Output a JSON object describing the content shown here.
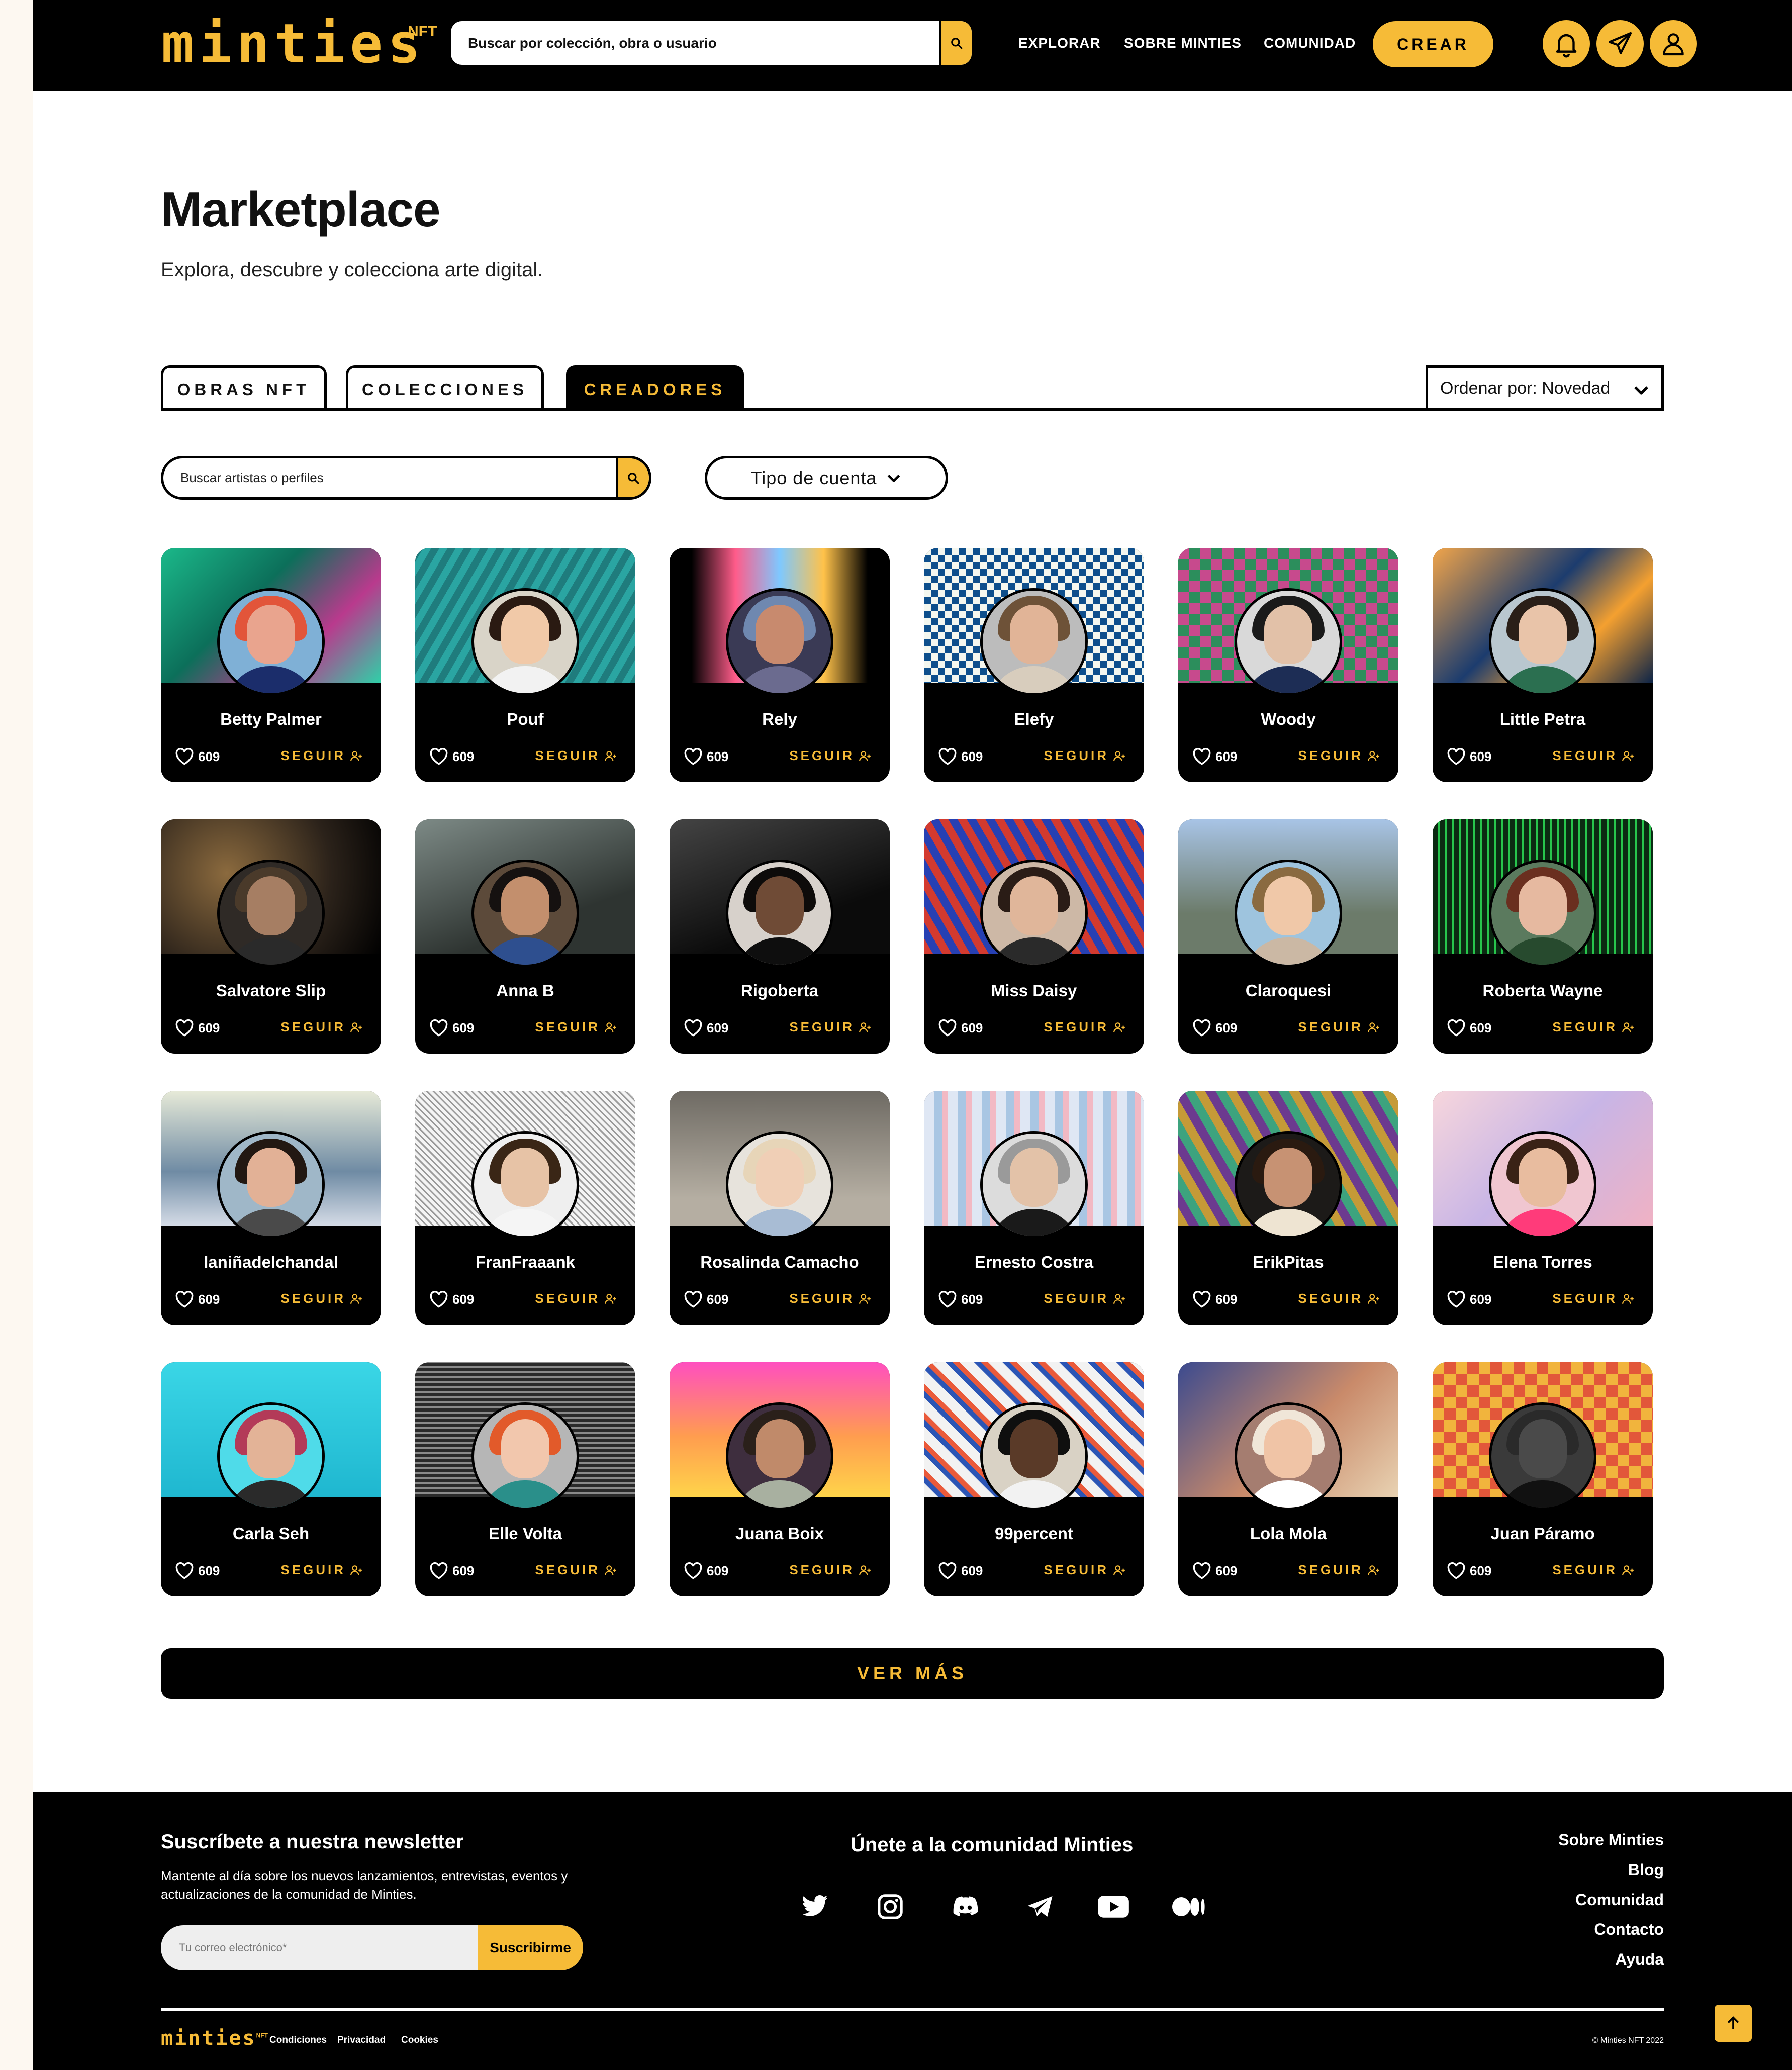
{
  "header": {
    "logo": "minties",
    "logo_sup": "NFT",
    "search_placeholder": "Buscar por colección, obra o usuario",
    "nav": [
      "EXPLORAR",
      "SOBRE MINTIES",
      "COMUNIDAD"
    ],
    "create_label": "CREAR",
    "icons": [
      "bell-icon",
      "paper-plane-icon",
      "user-icon"
    ]
  },
  "main": {
    "title": "Marketplace",
    "subtitle": "Explora, descubre y colecciona arte digital.",
    "tabs": [
      {
        "label": "OBRAS NFT",
        "active": false
      },
      {
        "label": "COLECCIONES",
        "active": false
      },
      {
        "label": "CREADORES",
        "active": true
      }
    ],
    "sort_label": "Ordenar por: Novedad",
    "filter_search_placeholder": "Buscar artistas o perfiles",
    "account_type_label": "Tipo de cuenta",
    "follow_label": "SEGUIR",
    "more_label": "VER MÁS"
  },
  "creators": [
    {
      "name": "Betty Palmer",
      "likes": "609"
    },
    {
      "name": "Pouf",
      "likes": "609"
    },
    {
      "name": "Rely",
      "likes": "609"
    },
    {
      "name": "Elefy",
      "likes": "609"
    },
    {
      "name": "Woody",
      "likes": "609"
    },
    {
      "name": "Little Petra",
      "likes": "609"
    },
    {
      "name": "Salvatore Slip",
      "likes": "609"
    },
    {
      "name": "Anna B",
      "likes": "609"
    },
    {
      "name": "Rigoberta",
      "likes": "609"
    },
    {
      "name": "Miss Daisy",
      "likes": "609"
    },
    {
      "name": "Claroquesi",
      "likes": "609"
    },
    {
      "name": "Roberta Wayne",
      "likes": "609"
    },
    {
      "name": "Ianiñadelchandal",
      "likes": "609"
    },
    {
      "name": "FranFraaank",
      "likes": "609"
    },
    {
      "name": "Rosalinda Camacho",
      "likes": "609"
    },
    {
      "name": "Ernesto Costra",
      "likes": "609"
    },
    {
      "name": "ErikPitas",
      "likes": "609"
    },
    {
      "name": "Elena Torres",
      "likes": "609"
    },
    {
      "name": "Carla Seh",
      "likes": "609"
    },
    {
      "name": "Elle Volta",
      "likes": "609"
    },
    {
      "name": "Juana Boix",
      "likes": "609"
    },
    {
      "name": "99percent",
      "likes": "609"
    },
    {
      "name": "Lola Mola",
      "likes": "609"
    },
    {
      "name": "Juan Páramo",
      "likes": "609"
    }
  ],
  "footer": {
    "newsletter_title": "Suscríbete a nuestra newsletter",
    "newsletter_text": "Mantente al día sobre los nuevos lanzamientos, entrevistas, eventos y actualizaciones de la comunidad de Minties.",
    "email_placeholder": "Tu correo electrónico*",
    "subscribe_label": "Suscribirme",
    "community_title": "Únete a la comunidad Minties",
    "social_icons": [
      "twitter-icon",
      "instagram-icon",
      "discord-icon",
      "telegram-icon",
      "youtube-icon",
      "medium-icon"
    ],
    "links": [
      "Sobre Minties",
      "Blog",
      "Comunidad",
      "Contacto",
      "Ayuda"
    ],
    "logo": "minties",
    "logo_sup": "NFT",
    "legal": [
      "Condiciones",
      "Privacidad",
      "Cookies"
    ],
    "copyright": "© Minties NFT 2022"
  },
  "colors": {
    "accent": "#f6bb37",
    "dark": "#000000",
    "page": "#ffffff"
  }
}
